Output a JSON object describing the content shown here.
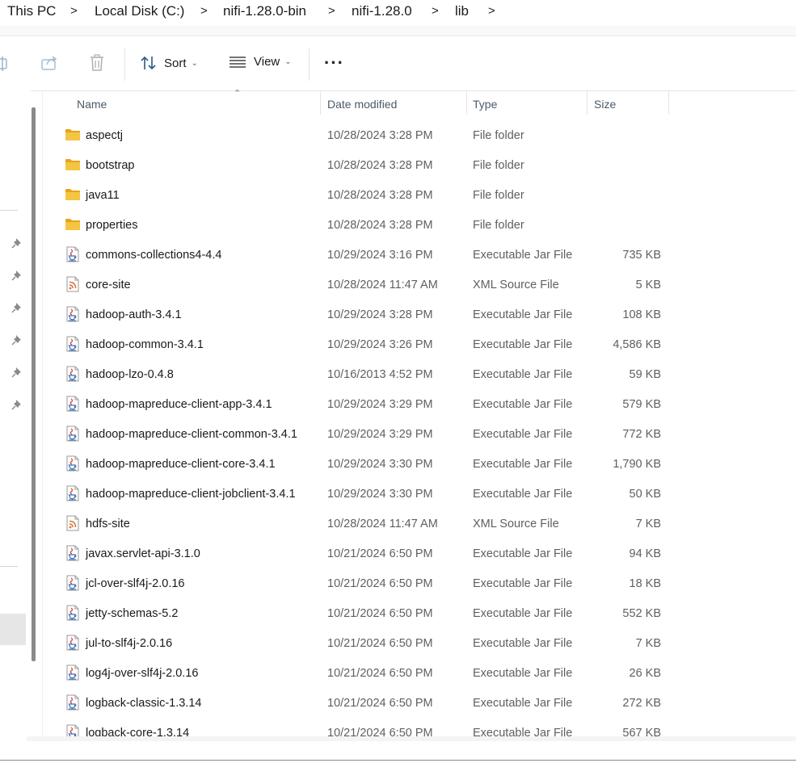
{
  "breadcrumb": {
    "items": [
      "This PC",
      "Local Disk (C:)",
      "nifi-1.28.0-bin",
      "nifi-1.28.0",
      "lib"
    ],
    "separator": ">"
  },
  "toolbar": {
    "sort_label": "Sort",
    "view_label": "View",
    "more_label": "···"
  },
  "columns": {
    "name": "Name",
    "date": "Date modified",
    "type": "Type",
    "size": "Size"
  },
  "files": [
    {
      "name": "aspectj",
      "date": "10/28/2024 3:28 PM",
      "type": "File folder",
      "size": "",
      "icon": "folder-icon"
    },
    {
      "name": "bootstrap",
      "date": "10/28/2024 3:28 PM",
      "type": "File folder",
      "size": "",
      "icon": "folder-icon"
    },
    {
      "name": "java11",
      "date": "10/28/2024 3:28 PM",
      "type": "File folder",
      "size": "",
      "icon": "folder-icon"
    },
    {
      "name": "properties",
      "date": "10/28/2024 3:28 PM",
      "type": "File folder",
      "size": "",
      "icon": "folder-icon"
    },
    {
      "name": "commons-collections4-4.4",
      "date": "10/29/2024 3:16 PM",
      "type": "Executable Jar File",
      "size": "735 KB",
      "icon": "jar-icon"
    },
    {
      "name": "core-site",
      "date": "10/28/2024 11:47 AM",
      "type": "XML Source File",
      "size": "5 KB",
      "icon": "xml-icon"
    },
    {
      "name": "hadoop-auth-3.4.1",
      "date": "10/29/2024 3:28 PM",
      "type": "Executable Jar File",
      "size": "108 KB",
      "icon": "jar-icon"
    },
    {
      "name": "hadoop-common-3.4.1",
      "date": "10/29/2024 3:26 PM",
      "type": "Executable Jar File",
      "size": "4,586 KB",
      "icon": "jar-icon"
    },
    {
      "name": "hadoop-lzo-0.4.8",
      "date": "10/16/2013 4:52 PM",
      "type": "Executable Jar File",
      "size": "59 KB",
      "icon": "jar-icon"
    },
    {
      "name": "hadoop-mapreduce-client-app-3.4.1",
      "date": "10/29/2024 3:29 PM",
      "type": "Executable Jar File",
      "size": "579 KB",
      "icon": "jar-icon"
    },
    {
      "name": "hadoop-mapreduce-client-common-3.4.1",
      "date": "10/29/2024 3:29 PM",
      "type": "Executable Jar File",
      "size": "772 KB",
      "icon": "jar-icon"
    },
    {
      "name": "hadoop-mapreduce-client-core-3.4.1",
      "date": "10/29/2024 3:30 PM",
      "type": "Executable Jar File",
      "size": "1,790 KB",
      "icon": "jar-icon"
    },
    {
      "name": "hadoop-mapreduce-client-jobclient-3.4.1",
      "date": "10/29/2024 3:30 PM",
      "type": "Executable Jar File",
      "size": "50 KB",
      "icon": "jar-icon"
    },
    {
      "name": "hdfs-site",
      "date": "10/28/2024 11:47 AM",
      "type": "XML Source File",
      "size": "7 KB",
      "icon": "xml-icon"
    },
    {
      "name": "javax.servlet-api-3.1.0",
      "date": "10/21/2024 6:50 PM",
      "type": "Executable Jar File",
      "size": "94 KB",
      "icon": "jar-icon"
    },
    {
      "name": "jcl-over-slf4j-2.0.16",
      "date": "10/21/2024 6:50 PM",
      "type": "Executable Jar File",
      "size": "18 KB",
      "icon": "jar-icon"
    },
    {
      "name": "jetty-schemas-5.2",
      "date": "10/21/2024 6:50 PM",
      "type": "Executable Jar File",
      "size": "552 KB",
      "icon": "jar-icon"
    },
    {
      "name": "jul-to-slf4j-2.0.16",
      "date": "10/21/2024 6:50 PM",
      "type": "Executable Jar File",
      "size": "7 KB",
      "icon": "jar-icon"
    },
    {
      "name": "log4j-over-slf4j-2.0.16",
      "date": "10/21/2024 6:50 PM",
      "type": "Executable Jar File",
      "size": "26 KB",
      "icon": "jar-icon"
    },
    {
      "name": "logback-classic-1.3.14",
      "date": "10/21/2024 6:50 PM",
      "type": "Executable Jar File",
      "size": "272 KB",
      "icon": "jar-icon"
    },
    {
      "name": "logback-core-1.3.14",
      "date": "10/21/2024 6:50 PM",
      "type": "Executable Jar File",
      "size": "567 KB",
      "icon": "jar-icon"
    }
  ],
  "colors": {
    "folder": "#f4c542",
    "folder_dark": "#e8a317",
    "xml": "#d9733b",
    "jar_red": "#d23a2a",
    "jar_blue": "#3d6fb4"
  }
}
